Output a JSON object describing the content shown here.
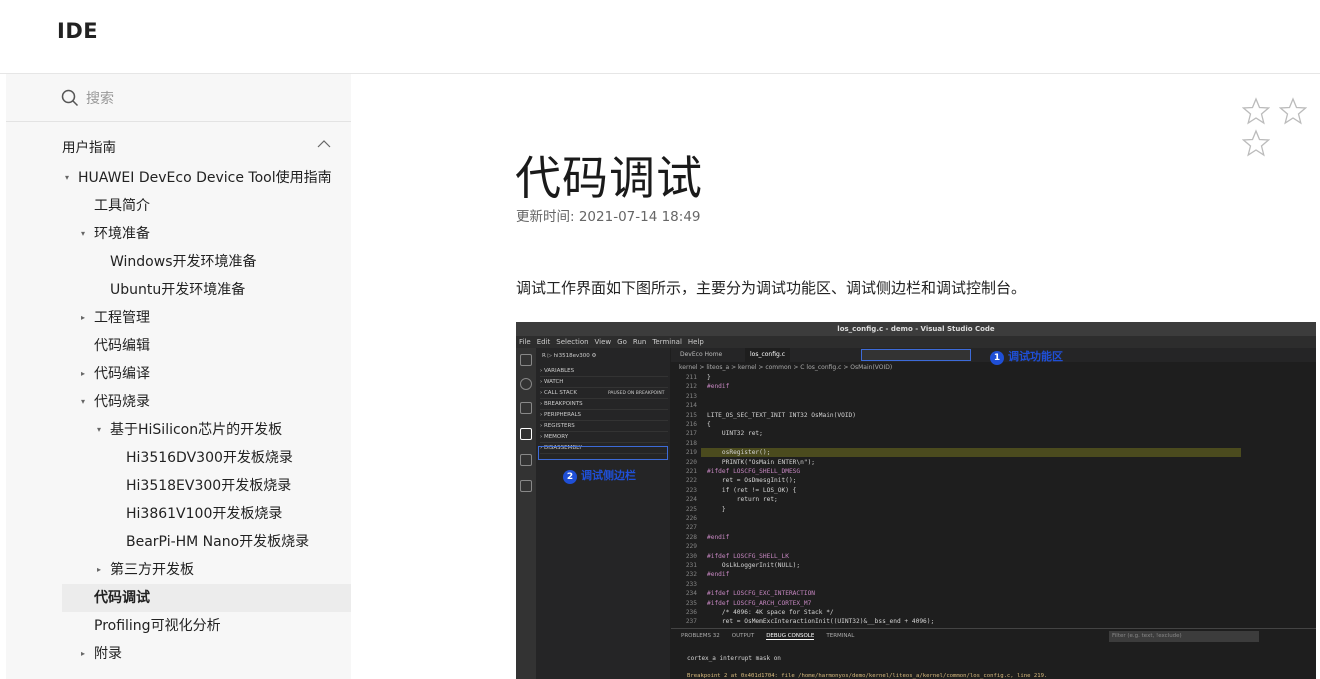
{
  "header": {
    "brand": "IDE"
  },
  "sidebar": {
    "search_placeholder": "搜索",
    "section_title": "用户指南",
    "items": [
      {
        "label": "HUAWEI DevEco Device Tool使用指南",
        "tri": "▾"
      },
      {
        "label": "工具简介",
        "tri": ""
      },
      {
        "label": "环境准备",
        "tri": "▾"
      },
      {
        "label": "Windows开发环境准备",
        "tri": ""
      },
      {
        "label": "Ubuntu开发环境准备",
        "tri": ""
      },
      {
        "label": "工程管理",
        "tri": "▸"
      },
      {
        "label": "代码编辑",
        "tri": ""
      },
      {
        "label": "代码编译",
        "tri": "▸"
      },
      {
        "label": "代码烧录",
        "tri": "▾"
      },
      {
        "label": "基于HiSilicon芯片的开发板",
        "tri": "▾"
      },
      {
        "label": "Hi3516DV300开发板烧录",
        "tri": ""
      },
      {
        "label": "Hi3518EV300开发板烧录",
        "tri": ""
      },
      {
        "label": "Hi3861V100开发板烧录",
        "tri": ""
      },
      {
        "label": "BearPi-HM Nano开发板烧录",
        "tri": ""
      },
      {
        "label": "第三方开发板",
        "tri": "▸"
      },
      {
        "label": "代码调试",
        "tri": ""
      },
      {
        "label": "Profiling可视化分析",
        "tri": ""
      },
      {
        "label": "附录",
        "tri": "▸"
      }
    ]
  },
  "article": {
    "title": "代码调试",
    "updated": "更新时间: 2021-07-14 18:49",
    "intro": "调试工作界面如下图所示，主要分为调试功能区、调试侧边栏和调试控制台。"
  },
  "screenshot": {
    "window_title": "los_config.c - demo - Visual Studio Code",
    "menu": [
      "File",
      "Edit",
      "Selection",
      "View",
      "Go",
      "Run",
      "Terminal",
      "Help"
    ],
    "debug_target": "hi3518ev300",
    "side_sections": [
      "VARIABLES",
      "WATCH",
      "CALL STACK",
      "BREAKPOINTS",
      "PERIPHERALS",
      "REGISTERS",
      "MEMORY",
      "DISASSEMBLY"
    ],
    "call_stack_status": "PAUSED ON BREAKPOINT",
    "tabs": [
      "DevEco Home",
      "los_config.c"
    ],
    "breadcrumb": "kernel > liteos_a > kernel > common > C los_config.c > OsMain(VOID)",
    "callout1": "调试功能区",
    "callout2": "调试侧边栏",
    "code_lines": [
      {
        "n": "211",
        "t": "}"
      },
      {
        "n": "212",
        "t": "#endif"
      },
      {
        "n": "213",
        "t": ""
      },
      {
        "n": "214",
        "t": ""
      },
      {
        "n": "215",
        "t": "LITE_OS_SEC_TEXT_INIT INT32 OsMain(VOID)"
      },
      {
        "n": "216",
        "t": "{"
      },
      {
        "n": "217",
        "t": "    UINT32 ret;"
      },
      {
        "n": "218",
        "t": ""
      },
      {
        "n": "219",
        "t": "    osRegister();"
      },
      {
        "n": "220",
        "t": "    PRINTK(\"OsMain ENTER\\n\");"
      },
      {
        "n": "221",
        "t": "#ifdef LOSCFG_SHELL_DMESG"
      },
      {
        "n": "222",
        "t": "    ret = OsDmesgInit();"
      },
      {
        "n": "223",
        "t": "    if (ret != LOS_OK) {"
      },
      {
        "n": "224",
        "t": "        return ret;"
      },
      {
        "n": "225",
        "t": "    }"
      },
      {
        "n": "226",
        "t": ""
      },
      {
        "n": "227",
        "t": ""
      },
      {
        "n": "228",
        "t": "#endif"
      },
      {
        "n": "229",
        "t": ""
      },
      {
        "n": "230",
        "t": "#ifdef LOSCFG_SHELL_LK"
      },
      {
        "n": "231",
        "t": "    OsLkLoggerInit(NULL);"
      },
      {
        "n": "232",
        "t": "#endif"
      },
      {
        "n": "233",
        "t": ""
      },
      {
        "n": "234",
        "t": "#ifdef LOSCFG_EXC_INTERACTION"
      },
      {
        "n": "235",
        "t": "#ifdef LOSCFG_ARCH_CORTEX_M7"
      },
      {
        "n": "236",
        "t": "    /* 4096: 4K space for Stack */"
      },
      {
        "n": "237",
        "t": "    ret = OsMemExcInteractionInit((UINT32)&__bss_end + 4096);"
      }
    ],
    "panel_tabs": [
      "PROBLEMS 32",
      "OUTPUT",
      "DEBUG CONSOLE",
      "TERMINAL"
    ],
    "panel_filter": "Filter (e.g. text, !exclude)",
    "console_line1": "cortex_a interrupt mask on",
    "console_line2": "Breakpoint 2 at 0x401d1704: file /home/harmonyos/demo/kernel/liteos_a/kernel/common/los_config.c, line 219."
  }
}
